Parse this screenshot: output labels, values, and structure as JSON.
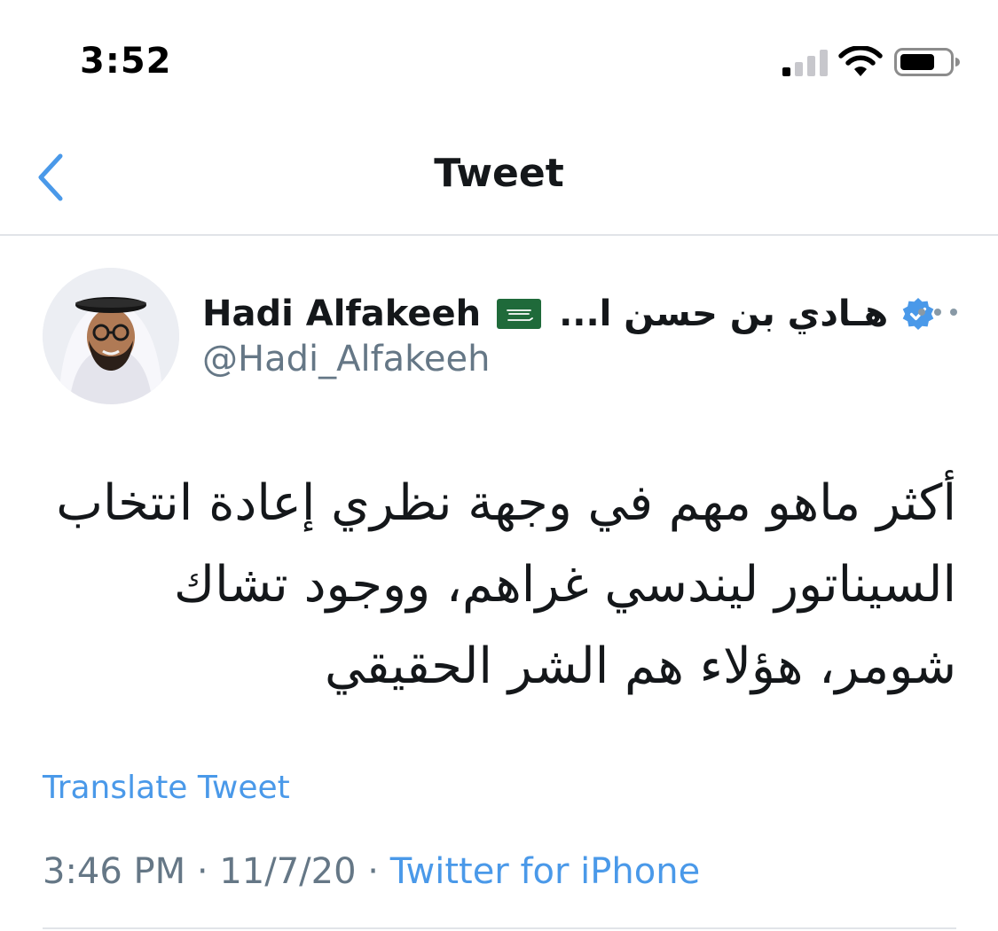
{
  "status_bar": {
    "time": "3:52"
  },
  "nav": {
    "title": "Tweet",
    "back_icon": "chevron-left-icon"
  },
  "tweet": {
    "author": {
      "display_name": "Hadi Alfakeeh",
      "arabic_name": "هـادي بن حسن ا...",
      "handle": "@Hadi_Alfakeeh",
      "verified": true,
      "flag_icon": "saudi-flag-icon"
    },
    "text": "أكثر ماهو مهم في وجهة نظري إعادة انتخاب السيناتور ليندسي غراهم، ووجود تشاك شومر، هؤلاء هم الشر الحقيقي",
    "translate_label": "Translate Tweet",
    "time": "3:46 PM",
    "separator": "·",
    "date": "11/7/20",
    "source": "Twitter for iPhone"
  },
  "colors": {
    "accent": "#4a99e9",
    "secondary_text": "#657786",
    "primary_text": "#14171a",
    "divider": "#e1e4e8"
  }
}
